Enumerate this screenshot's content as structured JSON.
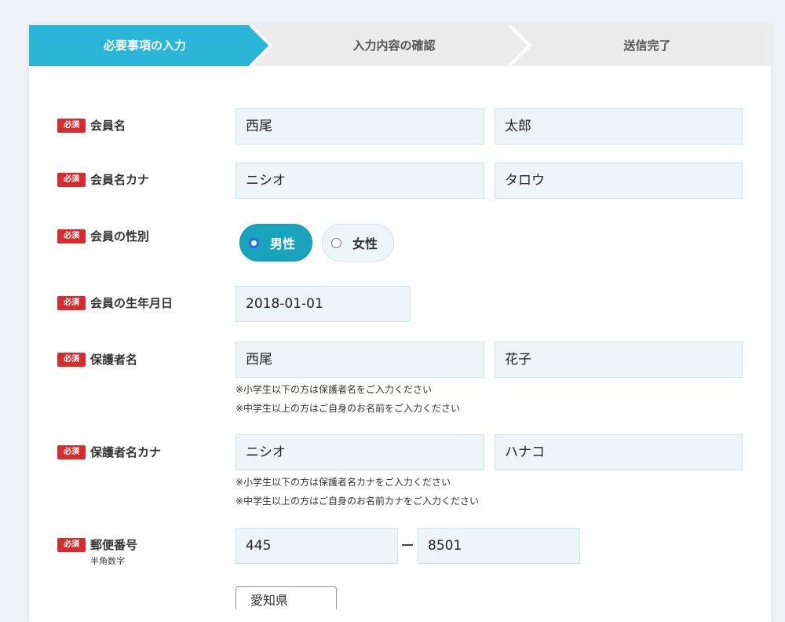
{
  "steps": [
    {
      "label": "必要事項の入力",
      "active": true
    },
    {
      "label": "入力内容の確認",
      "active": false
    },
    {
      "label": "送信完了",
      "active": false
    }
  ],
  "colors": {
    "accent": "#29b6d8",
    "required": "#d92b2b",
    "radio_on": "#1aa3bd"
  },
  "required_badge": "必須",
  "form": {
    "member_name": {
      "label": "会員名",
      "last": "西尾",
      "first": "太郎"
    },
    "member_kana": {
      "label": "会員名カナ",
      "last": "ニシオ",
      "first": "タロウ"
    },
    "gender": {
      "label": "会員の性別",
      "options": [
        "男性",
        "女性"
      ],
      "selected": "男性"
    },
    "birthdate": {
      "label": "会員の生年月日",
      "value": "2018-01-01"
    },
    "guardian_name": {
      "label": "保護者名",
      "last": "西尾",
      "first": "花子",
      "notes": [
        "※小学生以下の方は保護者名をご入力ください",
        "※中学生以上の方はご自身のお名前をご入力ください"
      ]
    },
    "guardian_kana": {
      "label": "保護者名カナ",
      "last": "ニシオ",
      "first": "ハナコ",
      "notes": [
        "※小学生以下の方は保護者名カナをご入力ください",
        "※中学生以上の方はご自身のお名前カナをご入力ください"
      ]
    },
    "postal": {
      "label": "郵便番号",
      "sublabel": "半角数字",
      "part1": "445",
      "part2": "8501"
    },
    "prefecture": {
      "value": "愛知県"
    }
  }
}
